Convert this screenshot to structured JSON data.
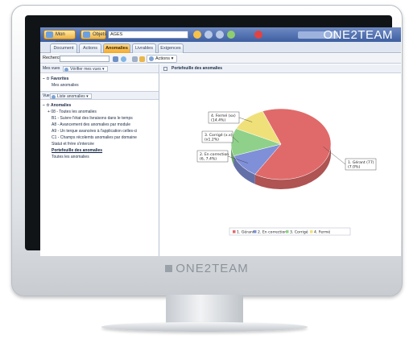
{
  "brand": "ONE2TEAM",
  "titlebar": {
    "home_label": "Mon espace",
    "project_label": "Objets",
    "project_value": "AGES"
  },
  "tabs": [
    {
      "label": "Document",
      "active": false
    },
    {
      "label": "Actions",
      "active": false
    },
    {
      "label": "Anomalies",
      "active": true
    },
    {
      "label": "Livrables",
      "active": false
    },
    {
      "label": "Exigences",
      "active": false
    }
  ],
  "toolbar": {
    "search_label": "Rechercher",
    "actions_label": "Actions"
  },
  "left_panel": {
    "header_label": "Mes vues",
    "header_select": "Vérifier mes vues",
    "favorites_title": "Favorites",
    "favorites_item": "Mes anomalies",
    "filter_label": "Vue",
    "filter_select": "Liste anomalies",
    "tree": [
      {
        "label": "Anomalies",
        "style": "bold"
      },
      {
        "label": "08 - Toutes les anomalies",
        "style": "normal"
      },
      {
        "label": "B1 - Suivre l'état des livraisons dans le temps",
        "style": "normal"
      },
      {
        "label": "A8 - Avancement des anomalies par module",
        "style": "normal"
      },
      {
        "label": "A9 - Un terque avancées à l'application celles-ci",
        "style": "normal"
      },
      {
        "label": "C1 - Champs récolemts anomalies par domaine",
        "style": "normal"
      },
      {
        "label": "Statut et frère s'intercée",
        "style": "normal"
      },
      {
        "label": "Portefeuille des anomalies",
        "style": "selected"
      },
      {
        "label": "Toutes les anomalies",
        "style": "normal"
      }
    ]
  },
  "main_panel": {
    "title": "Portefeuille des anomalies"
  },
  "colors": {
    "titlebar": "#3d5ea0",
    "tab_active": "#f2a92c",
    "slice_1": "#e06a6a",
    "slice_2": "#7f8fd8",
    "slice_3": "#8fd18a",
    "slice_4": "#f0e07a"
  },
  "chart_data": {
    "type": "pie",
    "title": "",
    "slices": [
      {
        "name": "1. Gérant",
        "value": 77,
        "label": "1. Gérant (77)\n(7.0%)",
        "color": "#e06a6a"
      },
      {
        "name": "2. Correction",
        "value": 13,
        "label": "2. En correction\n(6, 7.4%)",
        "color": "#7f8fd8"
      },
      {
        "name": "3. Corrigé",
        "value": 15,
        "label": "3. Corrigé (x.x)\n(x1.2%)",
        "color": "#8fd18a"
      },
      {
        "name": "4. Fermé",
        "value": 14,
        "label": "4. Fermé (xx)\n(14.4%)",
        "color": "#f0e07a"
      }
    ],
    "legend": [
      {
        "label": "1. Gérant",
        "color": "#e06a6a"
      },
      {
        "label": "2. En correction",
        "color": "#7f8fd8"
      },
      {
        "label": "3. Corrigé",
        "color": "#8fd18a"
      },
      {
        "label": "4. Fermé",
        "color": "#f0e07a"
      }
    ],
    "legend_position": "bottom"
  },
  "monitor_logo": "ONE2TEAM"
}
